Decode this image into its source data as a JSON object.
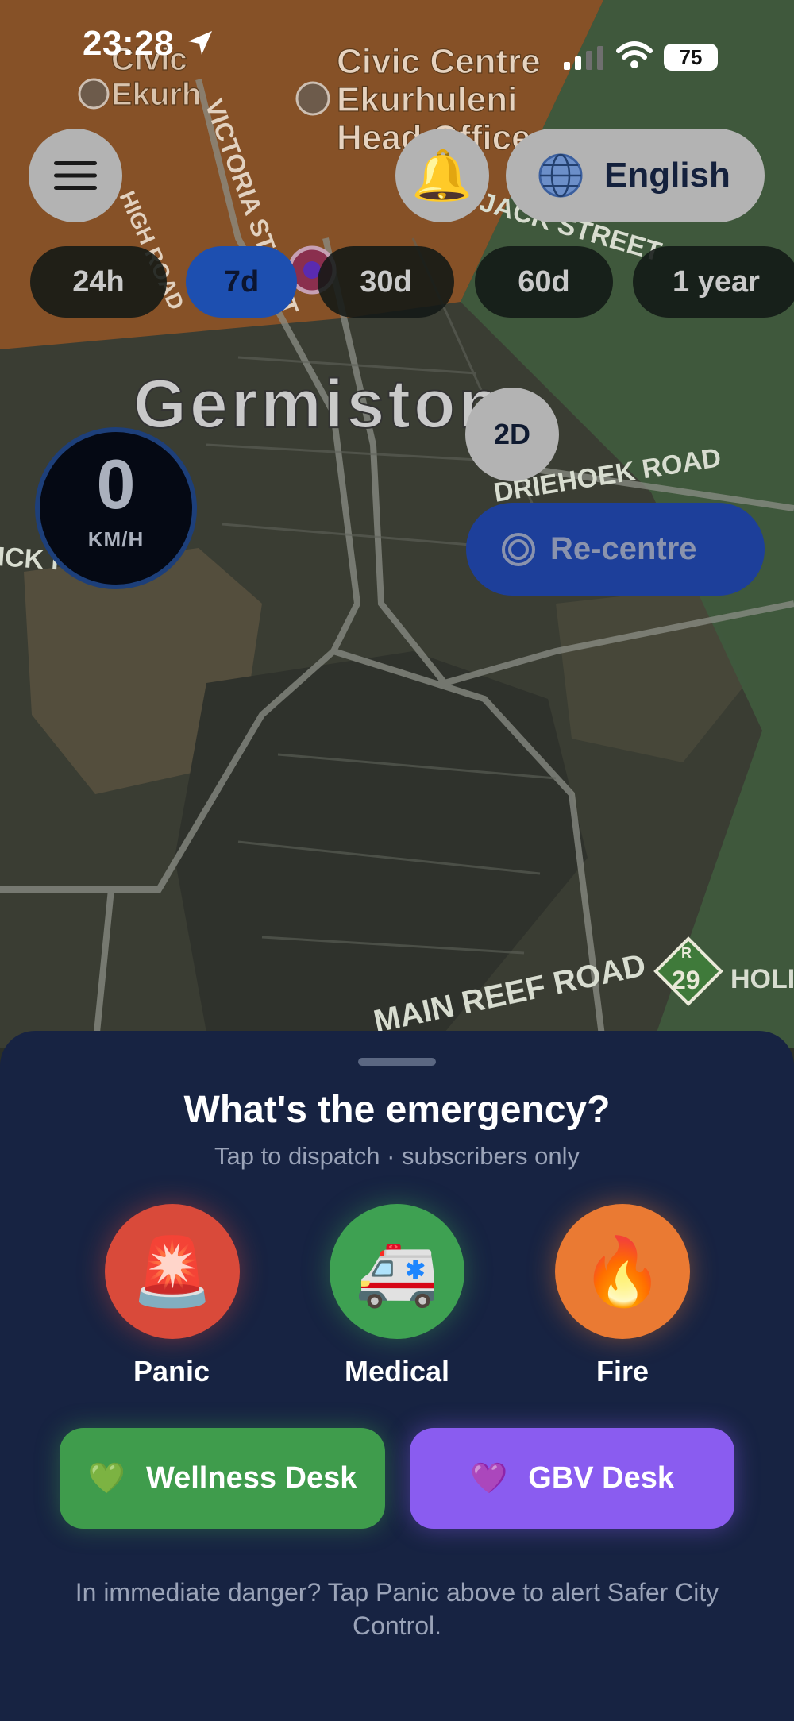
{
  "status_bar": {
    "time": "23:28",
    "battery": "75"
  },
  "map": {
    "place_label": "Germiston",
    "poi_labels": [
      "Civic",
      "Ekurh",
      "Civic Centre",
      "Ekurhuleni",
      "Head Office"
    ],
    "road_labels": [
      "VICTORIA STREET",
      "HIGH ROAD",
      "JACK STREET",
      "DRIEHOEK ROAD",
      "MAIN REEF ROAD",
      "HOLI",
      "ICK R"
    ],
    "route_shield": {
      "letter": "R",
      "number": "29"
    }
  },
  "header": {
    "language_label": "English"
  },
  "time_ranges": {
    "items": [
      "24h",
      "7d",
      "30d",
      "60d",
      "1 year"
    ],
    "selected": "7d"
  },
  "speed": {
    "value": "0",
    "unit": "KM/H"
  },
  "view_toggle": {
    "label": "2D"
  },
  "recentre": {
    "label": "Re-centre"
  },
  "sheet": {
    "title": "What's the emergency?",
    "subtitle": "Tap to dispatch · subscribers only",
    "emergencies": [
      {
        "label": "Panic",
        "icon": "🚨"
      },
      {
        "label": "Medical",
        "icon": "🚑"
      },
      {
        "label": "Fire",
        "icon": "🔥"
      }
    ],
    "desks": [
      {
        "label": "Wellness Desk",
        "icon": "💚"
      },
      {
        "label": "GBV Desk",
        "icon": "💜"
      }
    ],
    "footer_note": "In immediate danger? Tap Panic above to alert Safer City Control."
  },
  "colors": {
    "sheet_bg": "#172342",
    "panic": "#d94a3a",
    "medical": "#3ea152",
    "fire": "#ea7a33",
    "wellness": "#3f9c4c",
    "gbv": "#8a5cf0",
    "range_active": "#1d4fb0"
  }
}
